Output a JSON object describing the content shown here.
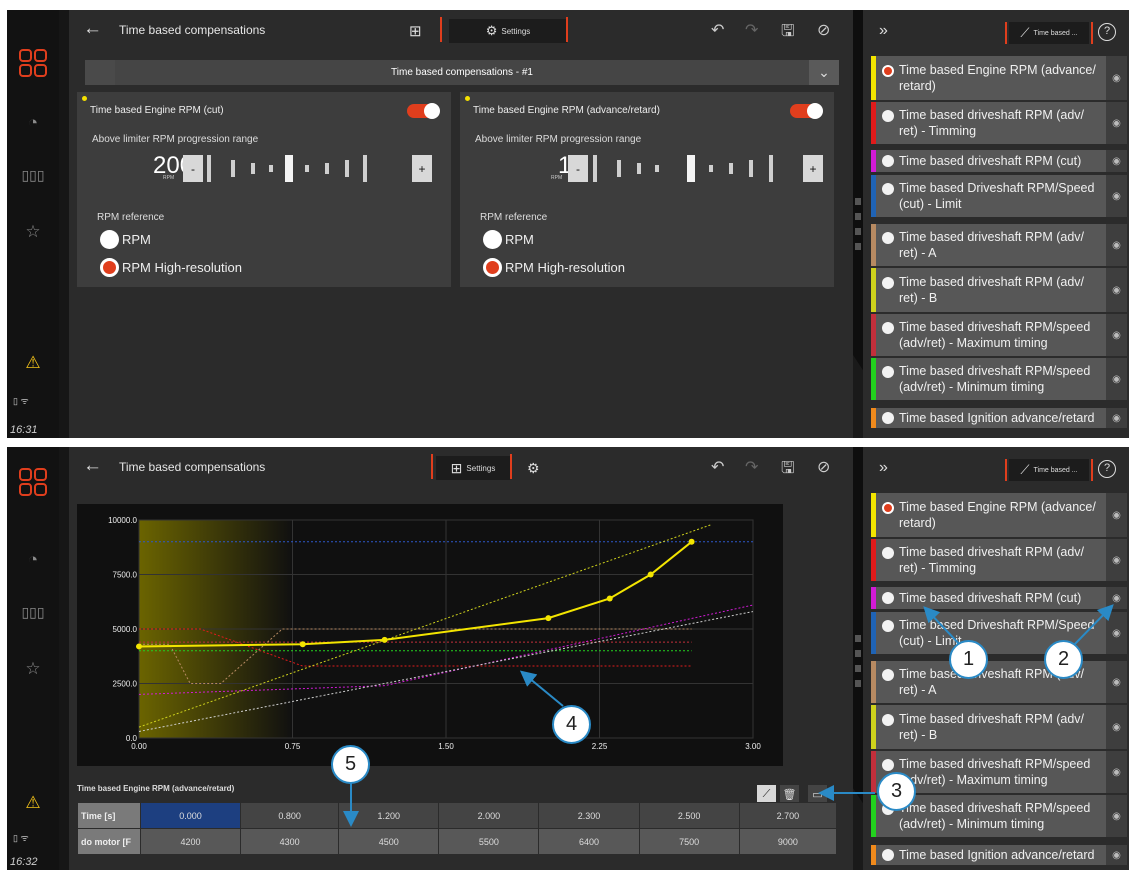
{
  "top": {
    "title": "Time based compensations",
    "settings_label": "Settings",
    "dropdown": "Time based compensations - #1",
    "clock": "16:31",
    "cards": [
      {
        "title": "Time based Engine RPM (cut)",
        "sub": "Above limiter RPM progression range",
        "value": "200",
        "unit": "RPM",
        "minus": "-",
        "plus": "+",
        "ref_label": "RPM reference",
        "opt1": "RPM",
        "opt2": "RPM High-resolution"
      },
      {
        "title": "Time based Engine RPM (advance/retard)",
        "sub": "Above limiter RPM progression range",
        "value": "1",
        "unit": "RPM",
        "minus": "-",
        "plus": "+",
        "ref_label": "RPM reference",
        "opt1": "RPM",
        "opt2": "RPM High-resolution"
      }
    ]
  },
  "right": {
    "tab_label": "Time based ...",
    "items": [
      {
        "label": "Time based Engine RPM (advance/ retard)",
        "color": "#f3e500",
        "selected": true
      },
      {
        "label": "Time based driveshaft RPM (adv/ ret) - Timming",
        "color": "#e01b1b",
        "selected": false
      },
      {
        "label": "Time based driveshaft RPM (cut)",
        "color": "#d21bd6",
        "selected": false
      },
      {
        "label": "Time based Driveshaft RPM/Speed (cut) - Limit",
        "color": "#1f63b5",
        "selected": false
      },
      {
        "label": "Time based driveshaft RPM (adv/ ret) - A",
        "color": "#b78a62",
        "selected": false
      },
      {
        "label": "Time based driveshaft RPM (adv/ ret) - B",
        "color": "#cfd21c",
        "selected": false
      },
      {
        "label": "Time based driveshaft RPM/speed (adv/ret) - Maximum timing",
        "color": "#c22f3b",
        "selected": false
      },
      {
        "label": "Time based driveshaft RPM/speed (adv/ret) - Minimum timing",
        "color": "#22d11e",
        "selected": false
      },
      {
        "label": "Time based Ignition advance/retard",
        "color": "#f08a1c",
        "selected": false
      }
    ]
  },
  "bottom": {
    "title": "Time based compensations",
    "settings_label": "Settings",
    "clock": "16:32",
    "table_title": "Time based Engine RPM (advance/retard)",
    "row_headers": [
      "Time [s]",
      "do motor [F"
    ],
    "time": [
      "0.000",
      "0.800",
      "1.200",
      "2.000",
      "2.300",
      "2.500",
      "2.700"
    ],
    "rpm": [
      "4200",
      "4300",
      "4500",
      "5500",
      "6400",
      "7500",
      "9000"
    ],
    "callouts": [
      "1",
      "2",
      "3",
      "4",
      "5"
    ]
  },
  "chart_data": {
    "type": "line",
    "xlim": [
      0,
      3.0
    ],
    "ylim": [
      0,
      10000
    ],
    "x_ticks": [
      "0.00",
      "0.75",
      "1.50",
      "2.25",
      "3.00"
    ],
    "y_ticks": [
      "0.0",
      "2500.0",
      "5000.0",
      "7500.0",
      "10000.0"
    ],
    "grid": true,
    "series": [
      {
        "color": "#f3e500",
        "x": [
          0,
          0.8,
          1.2,
          2.0,
          2.3,
          2.5,
          2.7
        ],
        "y": [
          4200,
          4300,
          4500,
          5500,
          6400,
          7500,
          9000
        ]
      }
    ],
    "reference_lines": [
      {
        "color": "#2d58c9",
        "x": [
          0,
          3.0
        ],
        "y": [
          9000,
          9000
        ]
      },
      {
        "color": "#22d11e",
        "x": [
          0,
          2.7
        ],
        "y": [
          4000,
          4000
        ]
      },
      {
        "color": "#c22f3b",
        "x": [
          0,
          2.7
        ],
        "y": [
          4400,
          4400
        ]
      },
      {
        "color": "#e01b1b",
        "x": [
          0,
          0.3,
          0.8,
          2.7
        ],
        "y": [
          5000,
          5000,
          3300,
          3300
        ]
      },
      {
        "color": "#b78a62",
        "x": [
          0,
          0.15,
          0.25,
          0.4,
          0.7,
          2.7
        ],
        "y": [
          4300,
          4300,
          2500,
          2500,
          5000,
          5000
        ]
      },
      {
        "color": "#d21bd6",
        "x": [
          0,
          1.2,
          3.0
        ],
        "y": [
          2000,
          2400,
          6100
        ]
      },
      {
        "color": "#cfd21c",
        "x": [
          0,
          2.8
        ],
        "y": [
          500,
          9800
        ]
      },
      {
        "color": "#cfcfcf",
        "x": [
          0,
          3.0
        ],
        "y": [
          300,
          5800
        ]
      }
    ]
  }
}
